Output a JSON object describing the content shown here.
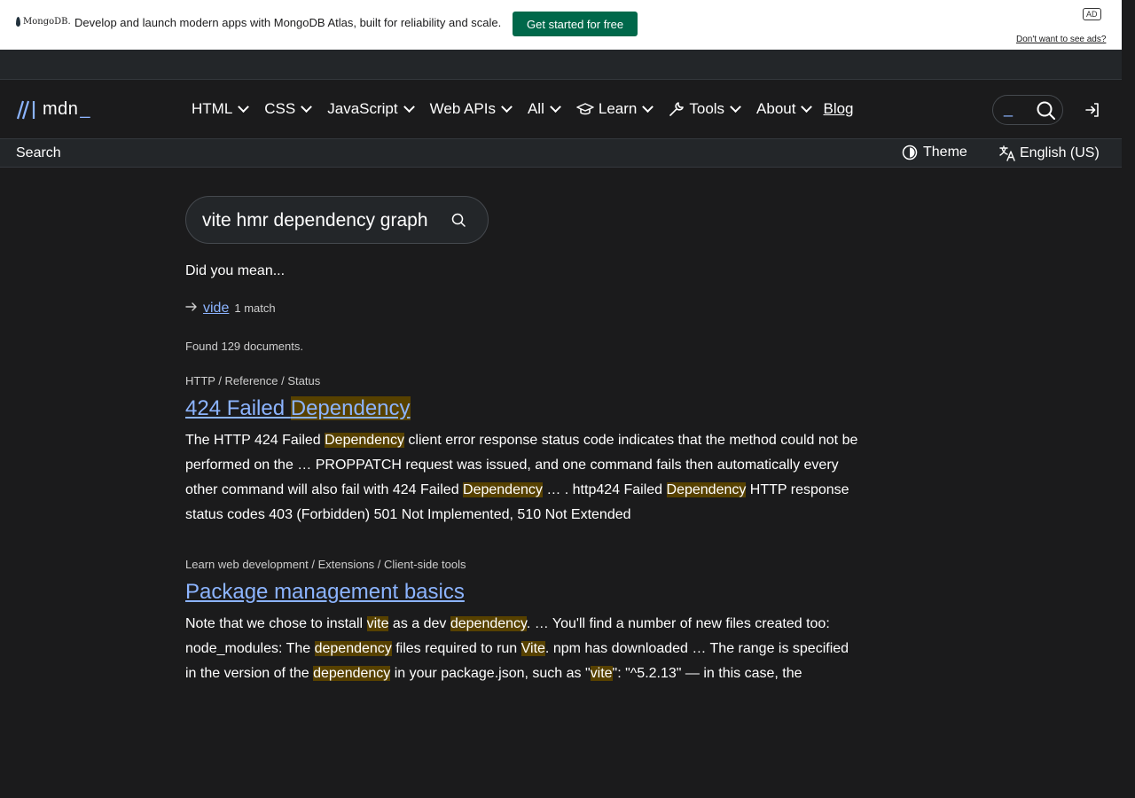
{
  "ad": {
    "logo_text": "MongoDB.",
    "text": "Develop and launch modern apps with MongoDB Atlas, built for reliability and scale.",
    "cta": "Get started for free",
    "badge": "AD",
    "optout": "Don't want to see ads?"
  },
  "nav": {
    "logo_text": "mdn",
    "logo_cursor": "_",
    "items": [
      {
        "label": "HTML"
      },
      {
        "label": "CSS"
      },
      {
        "label": "JavaScript"
      },
      {
        "label": "Web APIs"
      },
      {
        "label": "All"
      },
      {
        "label": "Learn"
      },
      {
        "label": "Tools"
      },
      {
        "label": "About"
      }
    ],
    "blog": "Blog",
    "search_cursor": "_"
  },
  "subnav": {
    "search": "Search",
    "theme": "Theme",
    "language": "English (US)"
  },
  "search": {
    "query": "vite hmr dependency graph"
  },
  "did_you_mean": {
    "label": "Did you mean...",
    "suggestion": "vide",
    "count": "1 match"
  },
  "found": "Found 129 documents.",
  "results": [
    {
      "breadcrumb": "HTTP / Reference / Status",
      "title_pre": "424 Failed ",
      "title_mark": "Dependency",
      "body": [
        {
          "t": "The HTTP 424 Failed "
        },
        {
          "m": "Dependency"
        },
        {
          "t": " client error response status code indicates that the method could not be performed on the … PROPPATCH request was issued, and one command fails then automatically every other command will also fail with 424 Failed "
        },
        {
          "m": "Dependency"
        },
        {
          "t": " … . http424 Failed "
        },
        {
          "m": "Dependency"
        },
        {
          "t": " HTTP response status codes 403 (Forbidden) 501 Not Implemented, 510 Not Extended"
        }
      ]
    },
    {
      "breadcrumb": "Learn web development / Extensions / Client-side tools",
      "title_pre": "Package management basics",
      "title_mark": "",
      "body": [
        {
          "t": "Note that we chose to install "
        },
        {
          "m": "vite"
        },
        {
          "t": " as a dev "
        },
        {
          "m": "dependency"
        },
        {
          "t": ". … You'll find a number of new files created too: node_modules: The "
        },
        {
          "m": "dependency"
        },
        {
          "t": " files required to run "
        },
        {
          "m": "Vite"
        },
        {
          "t": ". npm has downloaded … The range is specified in the version of the "
        },
        {
          "m": "dependency"
        },
        {
          "t": " in your package.json, such as \""
        },
        {
          "m": "vite"
        },
        {
          "t": "\": \"^5.2.13\" — in this case, the"
        }
      ]
    }
  ]
}
